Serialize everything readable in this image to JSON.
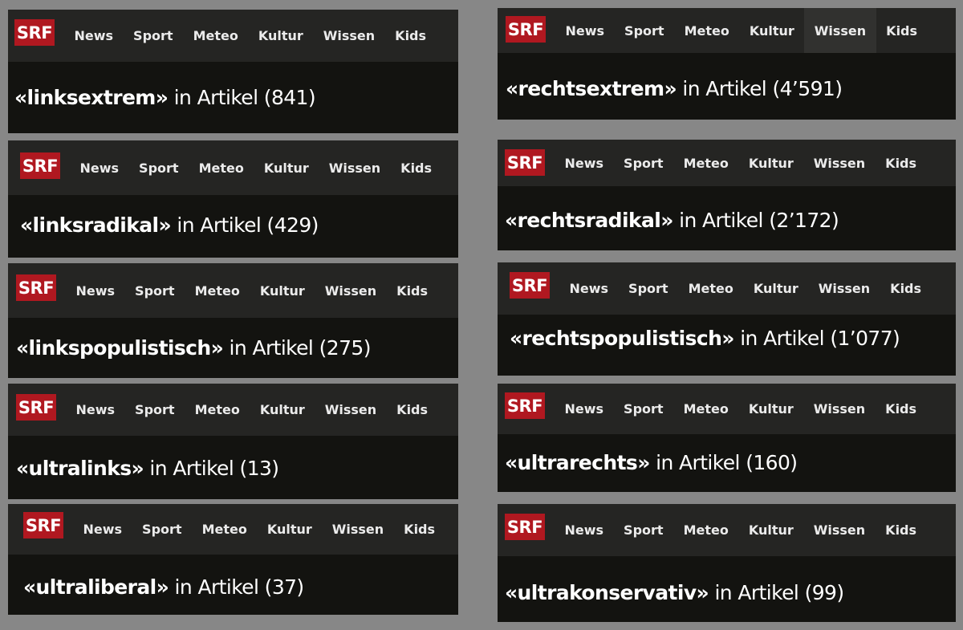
{
  "brand": {
    "logo_text": "SRF",
    "logo_color": "#b01820"
  },
  "nav_labels": [
    "News",
    "Sport",
    "Meteo",
    "Kultur",
    "Wissen",
    "Kids"
  ],
  "colors": {
    "background": "#878787",
    "panel_background": "#131310",
    "nav_background": "#252523",
    "active_tab_background": "#31312f"
  },
  "panels": [
    {
      "term": "«linksextrem»",
      "suffix": " in Artikel (841)",
      "active_tab": null
    },
    {
      "term": "«linksradikal»",
      "suffix": " in Artikel (429)",
      "active_tab": null
    },
    {
      "term": "«linkspopulistisch»",
      "suffix": " in Artikel (275)",
      "active_tab": null
    },
    {
      "term": "«ultralinks»",
      "suffix": " in Artikel (13)",
      "active_tab": null
    },
    {
      "term": "«ultraliberal»",
      "suffix": " in Artikel (37)",
      "active_tab": null
    },
    {
      "term": "«rechtsextrem»",
      "suffix": " in Artikel (4’591)",
      "active_tab": "Wissen"
    },
    {
      "term": "«rechtsradikal»",
      "suffix": " in Artikel (2’172)",
      "active_tab": null
    },
    {
      "term": "«rechtspopulistisch»",
      "suffix": " in Artikel (1’077)",
      "active_tab": null
    },
    {
      "term": "«ultrarechts»",
      "suffix": " in Artikel (160)",
      "active_tab": null
    },
    {
      "term": "«ultrakonservativ»",
      "suffix": " in Artikel (99)",
      "active_tab": null
    }
  ]
}
